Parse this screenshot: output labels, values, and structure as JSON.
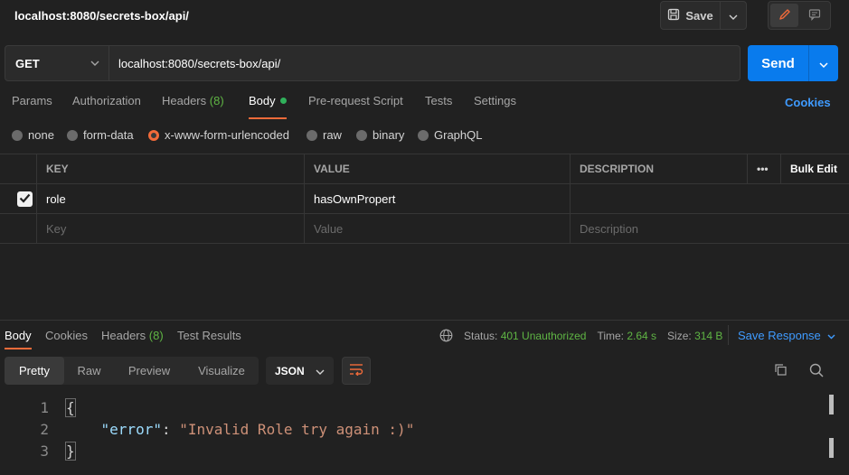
{
  "header": {
    "title": "localhost:8080/secrets-box/api/",
    "save_label": "Save"
  },
  "request": {
    "method": "GET",
    "url": "localhost:8080/secrets-box/api/",
    "send_label": "Send"
  },
  "req_tabs": {
    "params": "Params",
    "authorization": "Authorization",
    "headers": "Headers",
    "headers_count": "(8)",
    "body": "Body",
    "prerequest": "Pre-request Script",
    "tests": "Tests",
    "settings": "Settings",
    "cookies": "Cookies"
  },
  "body_types": {
    "none": "none",
    "form_data": "form-data",
    "urlencoded": "x-www-form-urlencoded",
    "raw": "raw",
    "binary": "binary",
    "graphql": "GraphQL",
    "selected": "x-www-form-urlencoded"
  },
  "params_table": {
    "col_key": "KEY",
    "col_value": "VALUE",
    "col_description": "DESCRIPTION",
    "more": "•••",
    "bulk_edit": "Bulk Edit",
    "rows": [
      {
        "key": "role",
        "value": "hasOwnPropert",
        "description": "",
        "checked": true
      }
    ],
    "placeholder_key": "Key",
    "placeholder_value": "Value",
    "placeholder_description": "Description"
  },
  "response": {
    "tabs": {
      "body": "Body",
      "cookies": "Cookies",
      "headers": "Headers",
      "headers_count": "(8)",
      "test_results": "Test Results"
    },
    "status_label": "Status:",
    "status_value": "401 Unauthorized",
    "time_label": "Time:",
    "time_value": "2.64 s",
    "size_label": "Size:",
    "size_value": "314 B",
    "save_response": "Save Response",
    "views": {
      "pretty": "Pretty",
      "raw": "Raw",
      "preview": "Preview",
      "visualize": "Visualize"
    },
    "format": "JSON",
    "code": {
      "line_numbers": [
        "1",
        "2",
        "3"
      ],
      "open_brace": "{",
      "key": "\"error\"",
      "colon": ": ",
      "value": "\"Invalid Role try again :)\"",
      "close_brace": "}"
    }
  },
  "colors": {
    "accent": "#f26b3a",
    "send_blue": "#097bed",
    "link_blue": "#3f9bff",
    "status_green": "#5fb544"
  },
  "icons": [
    "save-icon",
    "chevron-down-icon",
    "pencil-icon",
    "comment-icon",
    "globe-icon",
    "wrap-lines-icon",
    "copy-icon",
    "search-icon",
    "check-icon"
  ]
}
